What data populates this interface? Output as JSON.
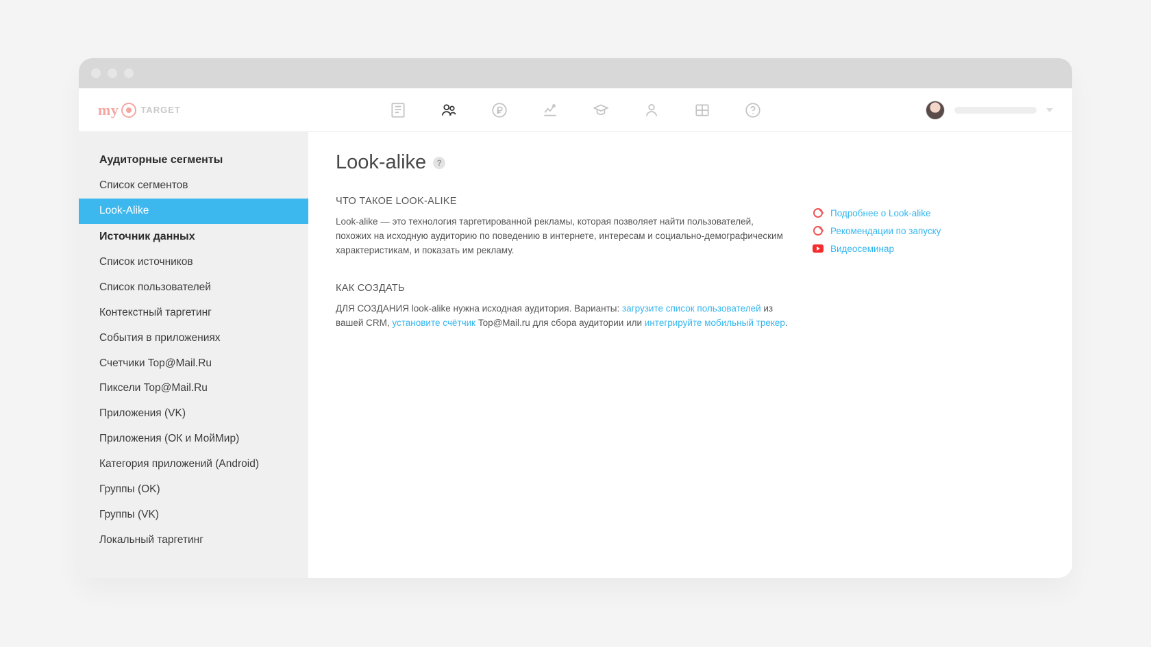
{
  "logo": {
    "brand_prefix": "my",
    "brand_suffix": "TARGET"
  },
  "nav_icons": [
    "campaigns",
    "audiences",
    "billing",
    "statistics",
    "education",
    "profile",
    "tools",
    "help"
  ],
  "sidebar": {
    "section1": "Аудиторные сегменты",
    "items1": [
      "Список сегментов",
      "Look-Alike"
    ],
    "section2": "Источник данных",
    "items2": [
      "Список источников",
      "Список пользователей",
      "Контекстный таргетинг",
      "События в приложениях",
      "Счетчики Top@Mail.Ru",
      "Пиксели Top@Mail.Ru",
      "Приложения (VK)",
      "Приложения (ОК и МойМир)",
      "Категория приложений (Android)",
      "Группы (OK)",
      "Группы (VK)",
      "Локальный таргетинг"
    ],
    "active": "Look-Alike"
  },
  "content": {
    "title": "Look-alike",
    "sub1": "ЧТО ТАКОЕ LOOK-ALIKE",
    "para1": "Look-alike — это технология таргетированной рекламы, которая позволяет найти пользователей, похожих на исходную аудиторию по поведению в интернете, интересам и социально-демографическим характеристикам, и показать им рекламу.",
    "sub2": "КАК СОЗДАТЬ",
    "para2_pre": "ДЛЯ СОЗДАНИЯ look-alike нужна исходная аудитория. Варианты: ",
    "para2_link1": "загрузите список пользователей",
    "para2_mid1": " из вашей CRM, ",
    "para2_link2": "установите счётчик",
    "para2_mid2": " Top@Mail.ru для сбора аудитории или ",
    "para2_link3": "интегрируйте мобильный трекер",
    "para2_end": "."
  },
  "aside": {
    "links": [
      {
        "icon": "target",
        "label": "Подробнее о Look-alike"
      },
      {
        "icon": "target",
        "label": "Рекомендации по запуску"
      },
      {
        "icon": "youtube",
        "label": "Видеосеминар"
      }
    ]
  }
}
